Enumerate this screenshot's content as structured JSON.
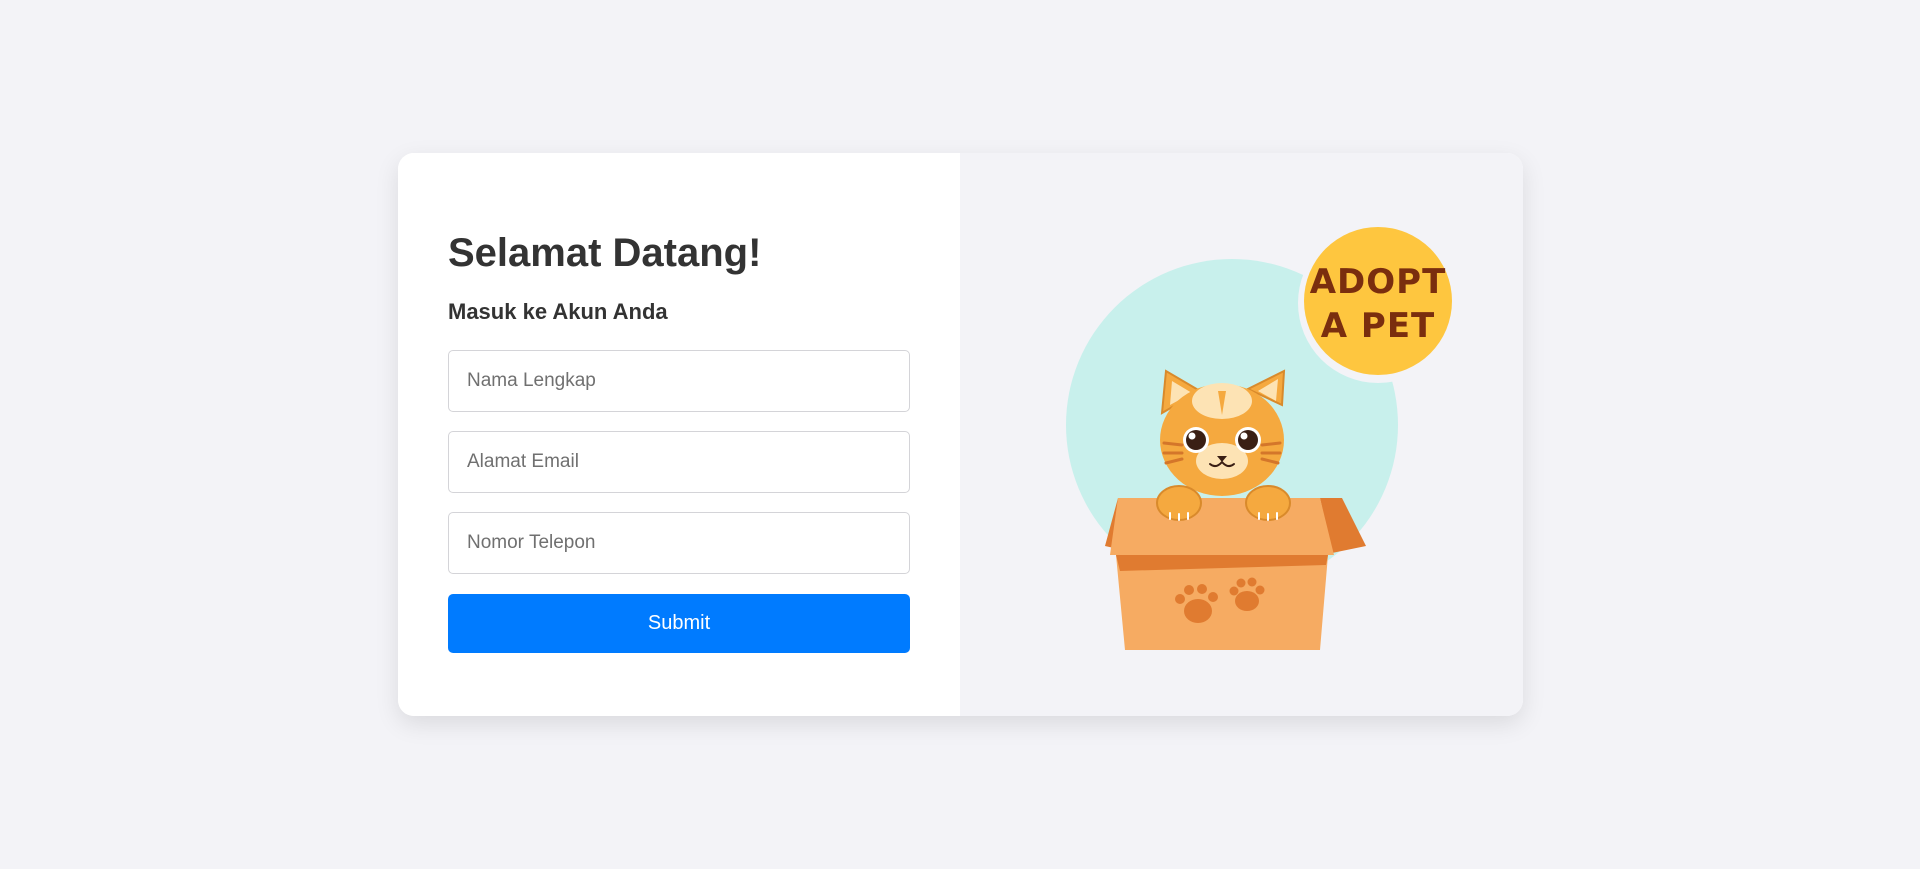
{
  "login": {
    "title": "Selamat Datang!",
    "subtitle": "Masuk ke Akun Anda",
    "fields": [
      {
        "name": "fullname",
        "placeholder": "Nama Lengkap",
        "value": ""
      },
      {
        "name": "email",
        "placeholder": "Alamat Email",
        "value": ""
      },
      {
        "name": "phone",
        "placeholder": "Nomor Telepon",
        "value": ""
      }
    ],
    "submit_label": "Submit"
  },
  "illustration": {
    "badge_line1": "ADOPT",
    "badge_line2": "A PET",
    "icons": [
      "cat-in-box-illustration",
      "paw-print-icon",
      "adopt-badge"
    ]
  },
  "colors": {
    "background": "#f3f3f7",
    "card": "#ffffff",
    "accent": "#007bff",
    "text": "#333333",
    "circle": "#c8f0ec",
    "badge": "#fec63f",
    "badge_text": "#7a2e0e",
    "box": "#f6ab62",
    "cat": "#f5a93f"
  }
}
